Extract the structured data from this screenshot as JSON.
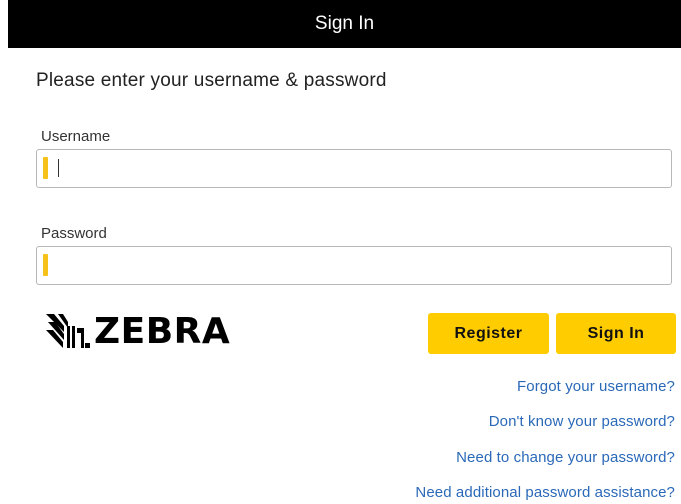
{
  "header": {
    "title": "Sign In"
  },
  "prompt": "Please enter your username & password",
  "username": {
    "label": "Username",
    "value": "",
    "placeholder": ""
  },
  "password": {
    "label": "Password",
    "value": "",
    "placeholder": ""
  },
  "brand": {
    "logo_text": "ZEBRA",
    "logo_icon": "zebra-head-icon"
  },
  "buttons": {
    "register": "Register",
    "sign_in": "Sign In"
  },
  "links": {
    "forgot_username": "Forgot your username?",
    "dont_know_password": "Don't know your password?",
    "change_password": "Need to change your password?",
    "password_assistance": "Need additional password assistance?"
  },
  "colors": {
    "header_bg": "#000000",
    "button_bg": "#ffcc00",
    "field_accent": "#f6c21a",
    "link": "#2a69b8"
  }
}
